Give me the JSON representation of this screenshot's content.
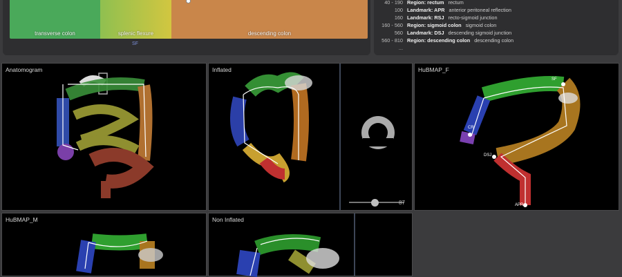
{
  "region_strip": {
    "segments": [
      {
        "label": "transverse colon",
        "color": "#4aa95a"
      },
      {
        "label": "splenic flexure",
        "color": "#b8c245"
      },
      {
        "label": "descending colon",
        "color": "#c9864a"
      }
    ],
    "cursor_label": "SF"
  },
  "legend": {
    "rows": [
      {
        "range": "40 - 190",
        "type": "Region: rectum",
        "desc": "rectum"
      },
      {
        "range": "100",
        "type": "Landmark: APR",
        "desc": "anterior peritoneal reflection"
      },
      {
        "range": "160",
        "type": "Landmark: RSJ",
        "desc": "recto-sigmoid junction"
      },
      {
        "range": "160 - 560",
        "type": "Region: sigmoid colon",
        "desc": "sigmoid colon"
      },
      {
        "range": "560",
        "type": "Landmark: DSJ",
        "desc": "descending sigmoid junction"
      },
      {
        "range": "560 - 810",
        "type": "Region: descending colon",
        "desc": "descending colon"
      },
      {
        "range": "...",
        "type": "",
        "desc": ""
      }
    ]
  },
  "panels": {
    "anatomogram": {
      "title": "Anatomogram"
    },
    "inflated": {
      "title": "Inflated"
    },
    "hubmap_f": {
      "title": "HuBMAP_F",
      "labels": [
        "SF",
        "CR",
        "DSJ",
        "APR"
      ]
    },
    "hubmap_m": {
      "title": "HuBMAP_M"
    },
    "non_inflated": {
      "title": "Non Inflated"
    },
    "cross_section": {
      "slider_value": "87"
    }
  }
}
